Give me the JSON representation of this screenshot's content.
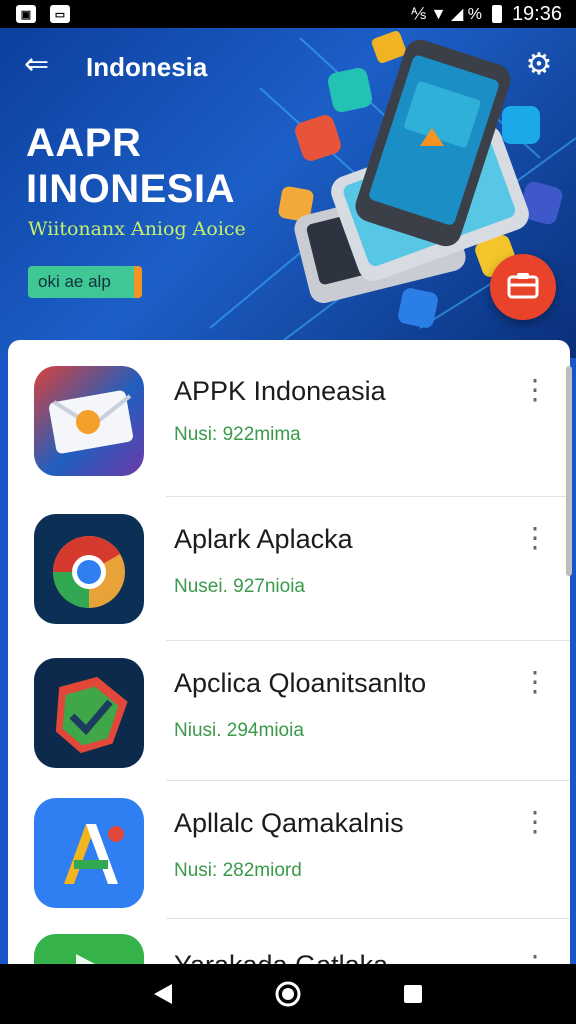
{
  "status_bar": {
    "left_icons": [
      "photo-icon",
      "media-icon"
    ],
    "right_text": "⅍ ▼ ◢ %",
    "time": "19:36"
  },
  "header": {
    "title": "Indonesia",
    "back_icon": "back-arrow-icon",
    "settings_icon": "gear-icon"
  },
  "banner": {
    "heading_line1": "AAPR",
    "heading_line2": "IINONESIA",
    "subtitle": "Wiitonanx Aniog Aoice",
    "button_label": "oki ae alp",
    "fab_icon": "app-window-icon"
  },
  "apps": [
    {
      "name": "APPK Indoneasia",
      "meta": "Nusi: 922mima",
      "icon": "mail-app-icon",
      "colors": [
        "#d9413b",
        "#1f5fbf",
        "#6d3aa8"
      ]
    },
    {
      "name": "Aplark Aplacka",
      "meta": "Nusei. 927nioia",
      "icon": "chrome-icon",
      "colors": [
        "#0b2f55"
      ]
    },
    {
      "name": "Apclica Qloanitsanlto",
      "meta": "Niusi. 294mioia",
      "icon": "checkmark-shield-icon",
      "colors": [
        "#0d2a4c"
      ]
    },
    {
      "name": "Apllalc Qamakalnis",
      "meta": "Nusi: 282miord",
      "icon": "letter-a-icon",
      "colors": [
        "#2f7ff2"
      ]
    },
    {
      "name": "Yarakada Gatlaka",
      "meta": "",
      "icon": "play-app-icon",
      "colors": [
        "#35b34a"
      ]
    }
  ],
  "nav": {
    "back": "back-triangle-icon",
    "home": "home-circle-icon",
    "recents": "recents-square-icon"
  },
  "colors": {
    "banner_blue": "#1c5fc7",
    "accent_green": "#3fc896",
    "fab_red": "#e9432c",
    "meta_green": "#3a9a4a"
  }
}
